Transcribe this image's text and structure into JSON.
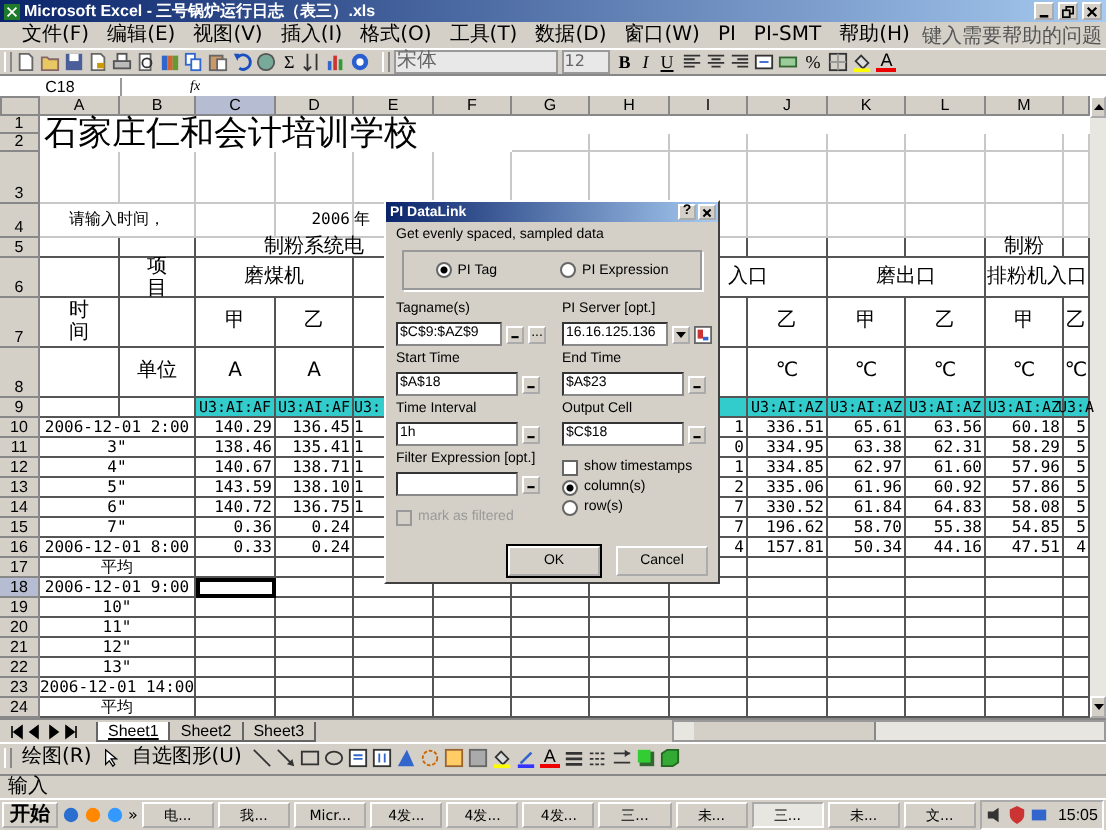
{
  "window": {
    "title": "Microsoft Excel - 三号锅炉运行日志（表三）.xls"
  },
  "menu": {
    "items": [
      "文件(F)",
      "编辑(E)",
      "视图(V)",
      "插入(I)",
      "格式(O)",
      "工具(T)",
      "数据(D)",
      "窗口(W)",
      "PI",
      "PI-SMT",
      "帮助(H)"
    ],
    "help_placeholder": "键入需要帮助的问题"
  },
  "standard_toolbar": {
    "sum": "Σ"
  },
  "format_toolbar": {
    "font": "宋体",
    "size": "12",
    "bold": "B",
    "italic": "I",
    "underline": "U",
    "percent": "%",
    "font_color": "A"
  },
  "formula_bar": {
    "cell": "C18",
    "fx": "fx"
  },
  "columns": [
    {
      "label": "A",
      "selected": false
    },
    {
      "label": "B",
      "selected": false
    },
    {
      "label": "C",
      "selected": true
    },
    {
      "label": "D",
      "selected": false
    },
    {
      "label": "E",
      "selected": false
    },
    {
      "label": "F",
      "selected": false
    },
    {
      "label": "G",
      "selected": false
    },
    {
      "label": "H",
      "selected": false
    },
    {
      "label": "I",
      "selected": false
    },
    {
      "label": "J",
      "selected": false
    },
    {
      "label": "K",
      "selected": false
    },
    {
      "label": "L",
      "selected": false
    },
    {
      "label": "M",
      "selected": false
    }
  ],
  "rows": [
    {
      "n": "1",
      "kind": "title",
      "selected": false,
      "cells": [
        {
          "text": "石家庄仁和会计培训学校"
        }
      ]
    },
    {
      "n": "2",
      "kind": "blank",
      "selected": false,
      "cells": []
    },
    {
      "n": "3",
      "kind": "blank",
      "selected": false,
      "cells": []
    },
    {
      "n": "4",
      "kind": "prompt",
      "selected": false,
      "cells": [
        {
          "text": "请输入时间，"
        },
        {
          "text": "2006"
        },
        {
          "text": "年"
        }
      ]
    },
    {
      "n": "5",
      "kind": "header",
      "selected": false,
      "cells": [
        {
          "text": "制粉系统电"
        },
        {
          "text": "制粉"
        }
      ]
    },
    {
      "n": "6",
      "kind": "header",
      "selected": false,
      "cells": [
        {
          "text": "项目",
          "kind": "vertical"
        },
        {
          "text": "磨煤机"
        },
        {
          "text": "入口"
        },
        {
          "text": "磨出口"
        },
        {
          "text": "排粉机入口"
        }
      ]
    },
    {
      "n": "7",
      "kind": "header",
      "selected": false,
      "cells": [
        {
          "text": "时间",
          "kind": "vertical"
        },
        {
          "text": "甲"
        },
        {
          "text": "乙"
        },
        {
          "text": "乙"
        },
        {
          "text": "甲"
        },
        {
          "text": "乙"
        },
        {
          "text": "甲"
        },
        {
          "text": "乙"
        }
      ]
    },
    {
      "n": "8",
      "kind": "header",
      "selected": false,
      "cells": [
        {
          "text": "单位"
        },
        {
          "text": "A"
        },
        {
          "text": "A"
        },
        {
          "text": "℃"
        },
        {
          "text": "℃"
        },
        {
          "text": "℃"
        },
        {
          "text": "℃"
        },
        {
          "text": "℃"
        }
      ]
    },
    {
      "n": "9",
      "kind": "tag",
      "selected": false,
      "cells": [
        {
          "text": "U3:AI:AF"
        },
        {
          "text": "U3:AI:AF"
        },
        {
          "text": "U3:"
        },
        {
          "text": "U3:AI:AZ"
        },
        {
          "text": "U3:AI:AZ"
        },
        {
          "text": "U3:AI:AZ"
        },
        {
          "text": "U3:AI:AZ"
        },
        {
          "text": "U3:A"
        }
      ]
    },
    {
      "n": "10",
      "kind": "data",
      "selected": false,
      "cells": [
        {
          "text": "2006-12-01 2:00"
        },
        {
          "text": "140.29"
        },
        {
          "text": "136.45"
        },
        {
          "text": "1"
        },
        {
          "text": "1"
        },
        {
          "text": "336.51"
        },
        {
          "text": "65.61"
        },
        {
          "text": "63.56"
        },
        {
          "text": "60.18"
        },
        {
          "text": "5"
        }
      ]
    },
    {
      "n": "11",
      "kind": "data",
      "selected": false,
      "cells": [
        {
          "text": "3\""
        },
        {
          "text": "138.46"
        },
        {
          "text": "135.41"
        },
        {
          "text": "1"
        },
        {
          "text": "0"
        },
        {
          "text": "334.95"
        },
        {
          "text": "63.38"
        },
        {
          "text": "62.31"
        },
        {
          "text": "58.29"
        },
        {
          "text": "5"
        }
      ]
    },
    {
      "n": "12",
      "kind": "data",
      "selected": false,
      "cells": [
        {
          "text": "4\""
        },
        {
          "text": "140.67"
        },
        {
          "text": "138.71"
        },
        {
          "text": "1"
        },
        {
          "text": "1"
        },
        {
          "text": "334.85"
        },
        {
          "text": "62.97"
        },
        {
          "text": "61.60"
        },
        {
          "text": "57.96"
        },
        {
          "text": "5"
        }
      ]
    },
    {
      "n": "13",
      "kind": "data",
      "selected": false,
      "cells": [
        {
          "text": "5\""
        },
        {
          "text": "143.59"
        },
        {
          "text": "138.10"
        },
        {
          "text": "1"
        },
        {
          "text": "2"
        },
        {
          "text": "335.06"
        },
        {
          "text": "61.96"
        },
        {
          "text": "60.92"
        },
        {
          "text": "57.86"
        },
        {
          "text": "5"
        }
      ]
    },
    {
      "n": "14",
      "kind": "data",
      "selected": false,
      "cells": [
        {
          "text": "6\""
        },
        {
          "text": "140.72"
        },
        {
          "text": "136.75"
        },
        {
          "text": "1"
        },
        {
          "text": "7"
        },
        {
          "text": "330.52"
        },
        {
          "text": "61.84"
        },
        {
          "text": "64.83"
        },
        {
          "text": "58.08"
        },
        {
          "text": "5"
        }
      ]
    },
    {
      "n": "15",
      "kind": "data",
      "selected": false,
      "cells": [
        {
          "text": "7\""
        },
        {
          "text": "0.36"
        },
        {
          "text": "0.24"
        },
        {
          "text": "7"
        },
        {
          "text": "196.62"
        },
        {
          "text": "58.70"
        },
        {
          "text": "55.38"
        },
        {
          "text": "54.85"
        },
        {
          "text": "5"
        }
      ]
    },
    {
      "n": "16",
      "kind": "data",
      "selected": false,
      "cells": [
        {
          "text": "2006-12-01 8:00"
        },
        {
          "text": "0.33"
        },
        {
          "text": "0.24"
        },
        {
          "text": "4"
        },
        {
          "text": "157.81"
        },
        {
          "text": "50.34"
        },
        {
          "text": "44.16"
        },
        {
          "text": "47.51"
        },
        {
          "text": "4"
        }
      ]
    },
    {
      "n": "17",
      "kind": "data",
      "selected": false,
      "cells": [
        {
          "text": "平均"
        }
      ]
    },
    {
      "n": "18",
      "kind": "data",
      "selected": true,
      "cells": [
        {
          "text": "2006-12-01 9:00"
        },
        {
          "selected": true
        }
      ]
    },
    {
      "n": "19",
      "kind": "data",
      "selected": false,
      "cells": [
        {
          "text": "10\""
        }
      ]
    },
    {
      "n": "20",
      "kind": "data",
      "selected": false,
      "cells": [
        {
          "text": "11\""
        }
      ]
    },
    {
      "n": "21",
      "kind": "data",
      "selected": false,
      "cells": [
        {
          "text": "12\""
        }
      ]
    },
    {
      "n": "22",
      "kind": "data",
      "selected": false,
      "cells": [
        {
          "text": "13\""
        }
      ]
    },
    {
      "n": "23",
      "kind": "data",
      "selected": false,
      "cells": [
        {
          "text": "2006-12-01 14:00"
        }
      ]
    },
    {
      "n": "24",
      "kind": "data",
      "selected": false,
      "cells": [
        {
          "text": "平均"
        }
      ]
    }
  ],
  "sheet_tabs": [
    {
      "label": "Sheet1",
      "selected": true
    },
    {
      "label": "Sheet2",
      "selected": false
    },
    {
      "label": "Sheet3",
      "selected": false
    }
  ],
  "drawing_toolbar": {
    "draw": "绘图(R)",
    "autoshapes": "自选图形(U)",
    "font_color": "A"
  },
  "status_bar": {
    "mode": "输入"
  },
  "dialog": {
    "title": "PI DataLink",
    "help": "?",
    "subtitle": "Get evenly spaced, sampled data",
    "modes": [
      {
        "label": "PI Tag",
        "selected": true
      },
      {
        "label": "PI Expression",
        "selected": false
      }
    ],
    "fields": [
      {
        "label": "Tagname(s)",
        "value": "$C$9:$AZ$9",
        "kind": "ref-browse",
        "browse": "..."
      },
      {
        "label": "PI Server [opt.]",
        "value": "16.16.125.136",
        "kind": "combo"
      },
      {
        "label": "Start Time",
        "value": "$A$18",
        "kind": "ref"
      },
      {
        "label": "End Time",
        "value": "$A$23",
        "kind": "ref"
      },
      {
        "label": "Time Interval",
        "value": "1h",
        "kind": "ref"
      },
      {
        "label": "Output Cell",
        "value": "$C$18",
        "kind": "ref"
      },
      {
        "label": "Filter Expression [opt.]",
        "kind": "ref"
      }
    ],
    "mark_filtered": {
      "label": "mark as filtered",
      "checked": false,
      "disabled": true
    },
    "show_timestamps": {
      "label": "show timestamps",
      "checked": false
    },
    "layout_options": [
      {
        "label": "column(s)",
        "selected": true
      },
      {
        "label": "row(s)",
        "selected": false
      }
    ],
    "buttons": [
      "OK",
      "Cancel"
    ]
  },
  "taskbar": {
    "start": "开始",
    "more": "»",
    "buttons": [
      {
        "label": "电...",
        "selected": false
      },
      {
        "label": "我...",
        "selected": false
      },
      {
        "label": "Micr...",
        "selected": false
      },
      {
        "label": "4发...",
        "selected": false
      },
      {
        "label": "4发...",
        "selected": false
      },
      {
        "label": "4发...",
        "selected": false
      },
      {
        "label": "三...",
        "selected": false
      },
      {
        "label": "未...",
        "selected": false
      },
      {
        "label": "三...",
        "selected": true
      },
      {
        "label": "未...",
        "selected": false
      },
      {
        "label": "文...",
        "selected": false
      }
    ],
    "time": "15:05"
  }
}
